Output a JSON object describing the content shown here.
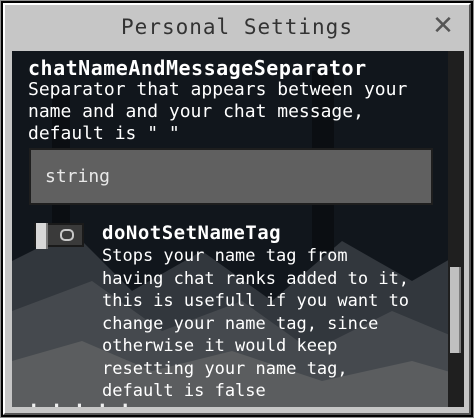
{
  "window": {
    "title": "Personal Settings",
    "close_icon": "close-icon"
  },
  "settings": [
    {
      "title": "chatNameAndMessageSeparator",
      "description": "Separator that appears between your\nname and and your chat message,\ndefault is \" \"",
      "input_value": "string"
    },
    {
      "title": "doNotSetNameTag",
      "description": "Stops your name tag from\nhaving chat ranks added to it,\nthis is usefull if you want to\nchange your name tag, since\notherwise it would keep\nresetting your name tag,\ndefault is false",
      "toggle_state": "off"
    }
  ],
  "partial_next_row": "·  ·  ·  ·  ·",
  "colors": {
    "window_bg": "#c6c6c6",
    "panel_bg": "#1b2330",
    "input_bg": "#606060",
    "text": "#ffffff"
  }
}
